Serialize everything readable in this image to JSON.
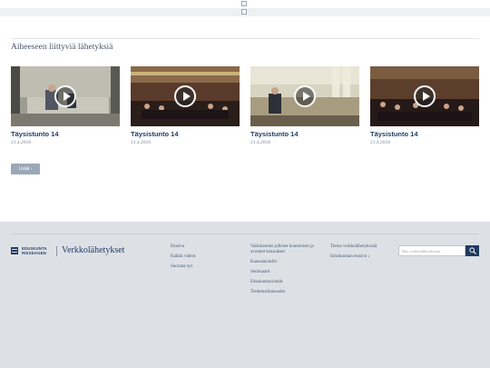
{
  "section": {
    "title": "Aiheeseen liittyviä lähetyksiä"
  },
  "videos": [
    {
      "title": "Täysistunto 14",
      "date": "21.4.2018"
    },
    {
      "title": "Täysistunto 14",
      "date": "21.4.2018"
    },
    {
      "title": "Täysistunto 14",
      "date": "21.4.2018"
    },
    {
      "title": "Täysistunto 14",
      "date": "21.4.2018"
    }
  ],
  "more_button": {
    "label": "Lisää ›"
  },
  "footer": {
    "logo": {
      "org_line1": "EDUSKUNTA",
      "org_line2": "RIKSDAGEN",
      "name": "Verkkolähetykset"
    },
    "col1": [
      "Etusivu",
      "Kaikki videot",
      "Suorana nyt"
    ],
    "col2": [
      "Valiokuntien julkiset kuulemiset ja avoimet kokoukset",
      "Kansalaisinfot",
      "Seminaarit",
      "Eduskuntaryhmät",
      "Tiedotustilaisuudet"
    ],
    "col3": [
      "Tietoa verkkolähetyksistä",
      "Eduskunnan etusivu ›"
    ],
    "search_placeholder": "Hae verkkolähetyksistä"
  },
  "colors": {
    "brand": "#1f3a5f",
    "footer_bg": "#dde1e6",
    "button": "#9aa8b8"
  },
  "icons": {
    "play": "play-icon",
    "search": "search-icon"
  }
}
